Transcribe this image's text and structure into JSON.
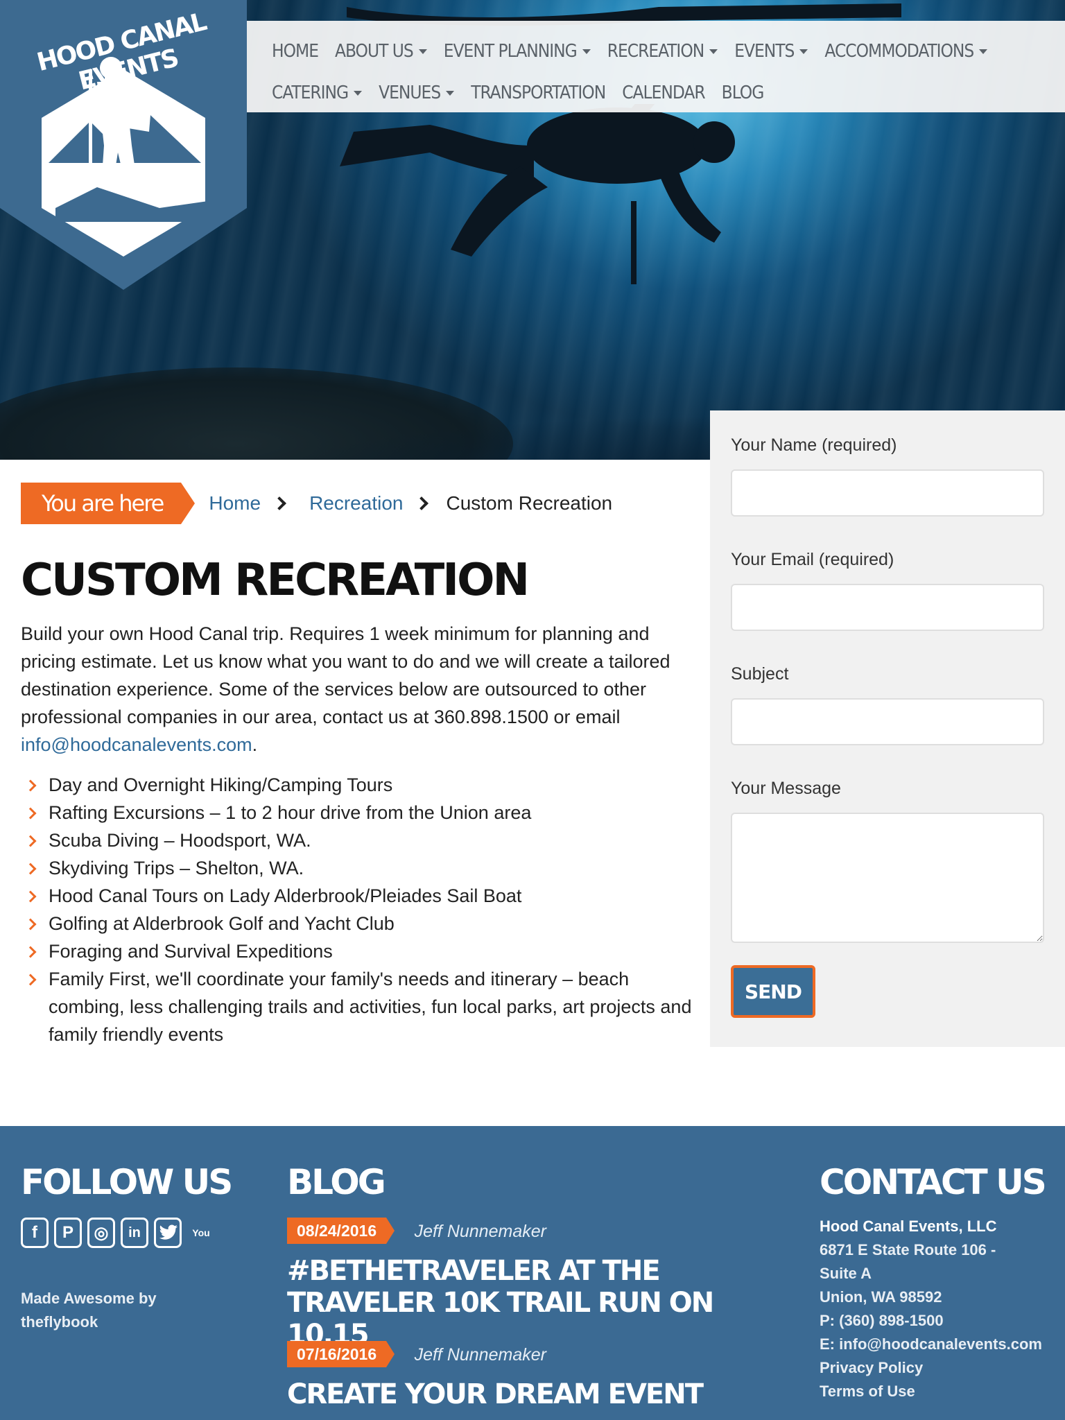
{
  "brand": {
    "logo_text": "HOOD CANAL EVENTS",
    "accent_color": "#ee6a24",
    "primary_color": "#3b6a93"
  },
  "nav": {
    "row1": [
      {
        "label": "HOME",
        "dropdown": false
      },
      {
        "label": "ABOUT US",
        "dropdown": true
      },
      {
        "label": "EVENT PLANNING",
        "dropdown": true
      },
      {
        "label": "RECREATION",
        "dropdown": true
      },
      {
        "label": "EVENTS",
        "dropdown": true
      },
      {
        "label": "ACCOMMODATIONS",
        "dropdown": true
      }
    ],
    "row2": [
      {
        "label": "CATERING",
        "dropdown": true
      },
      {
        "label": "VENUES",
        "dropdown": true
      },
      {
        "label": "TRANSPORTATION",
        "dropdown": false
      },
      {
        "label": "CALENDAR",
        "dropdown": false
      },
      {
        "label": "BLOG",
        "dropdown": false
      }
    ]
  },
  "breadcrumb": {
    "badge": "You are here",
    "home": "Home",
    "section": "Recreation",
    "current": "Custom Recreation"
  },
  "page": {
    "title": "CUSTOM RECREATION",
    "intro": "Build your own Hood Canal trip. Requires 1 week minimum for planning and pricing estimate. Let us know what you want to do and we will create a tailored destination experience. Some of the services below are outsourced to other professional companies in our area, contact us at 360.898.1500 or email ",
    "intro_email": "info@hoodcanalevents.com",
    "intro_end": ".",
    "services": [
      "Day and Overnight Hiking/Camping Tours",
      "Rafting Excursions – 1 to 2 hour drive from the Union area",
      "Scuba Diving – Hoodsport, WA.",
      "Skydiving Trips – Shelton, WA.",
      "Hood Canal Tours on Lady Alderbrook/Pleiades Sail Boat",
      "Golfing at Alderbrook Golf and Yacht Club",
      "Foraging and Survival Expeditions",
      "Family First, we'll coordinate your family's needs and itinerary – beach combing, less challenging trails and activities, fun local parks, art projects and family friendly events"
    ]
  },
  "form": {
    "name_label": "Your Name (required)",
    "email_label": "Your Email (required)",
    "subject_label": "Subject",
    "message_label": "Your Message",
    "send_label": "SEND"
  },
  "footer": {
    "follow_heading": "FOLLOW US",
    "social_icons": [
      "facebook-icon",
      "pinterest-icon",
      "instagram-icon",
      "linkedin-icon",
      "twitter-icon",
      "youtube-icon"
    ],
    "social_glyphs": {
      "facebook": "f",
      "pinterest": "P",
      "instagram": "◎",
      "linkedin": "in",
      "youtube": "You"
    },
    "made_by_line1": "Made Awesome by",
    "made_by_line2": "theflybook",
    "blog_heading": "BLOG",
    "posts": [
      {
        "date": "08/24/2016",
        "author": "Jeff Nunnemaker",
        "title": "#BETHETRAVELER AT THE TRAVELER 10K TRAIL RUN ON 10.15"
      },
      {
        "date": "07/16/2016",
        "author": "Jeff Nunnemaker",
        "title": "CREATE YOUR DREAM EVENT"
      }
    ],
    "contact_heading": "CONTACT US",
    "contact": {
      "company": "Hood Canal Events, LLC",
      "address1": "6871 E State Route 106 -",
      "address2": "Suite A",
      "city": "Union, WA 98592",
      "phone": "P: (360) 898-1500",
      "email": "E: info@hoodcanalevents.com",
      "privacy": "Privacy Policy",
      "terms": "Terms of Use"
    }
  }
}
